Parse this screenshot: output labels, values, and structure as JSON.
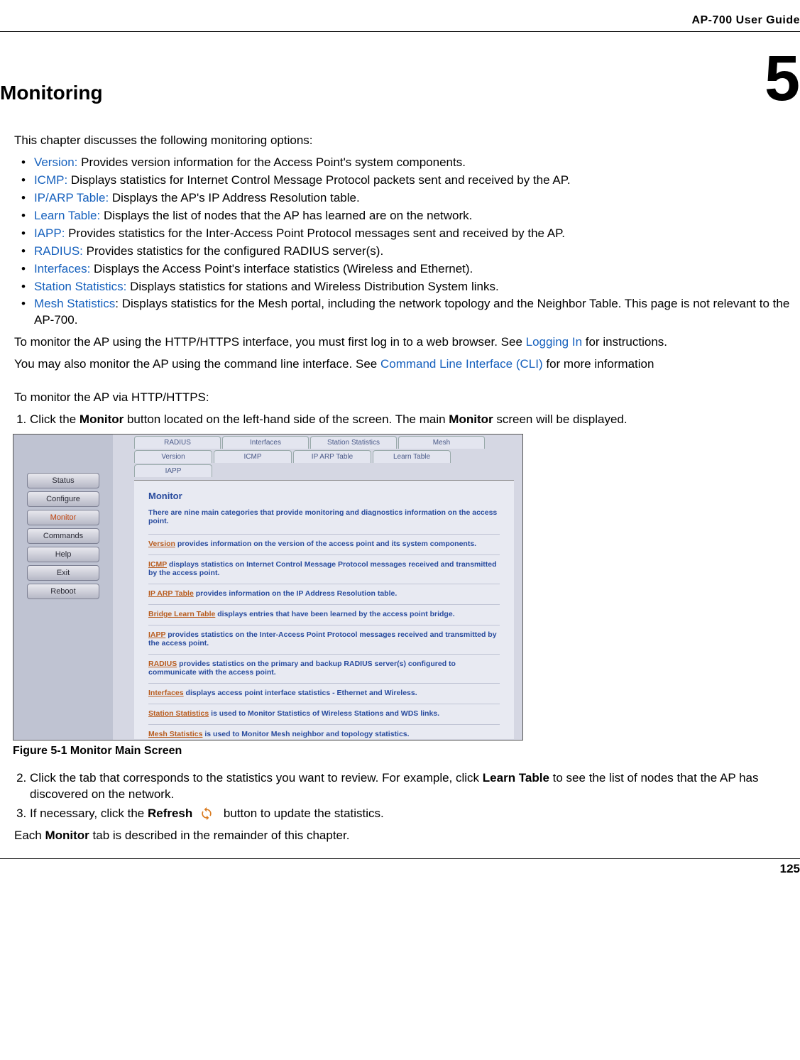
{
  "header": {
    "guide": "AP-700 User Guide"
  },
  "chapter": {
    "title": "Monitoring",
    "number": "5"
  },
  "intro": "This chapter discusses the following monitoring options:",
  "options": [
    {
      "link": "Version:",
      "desc": " Provides version information for the Access Point's system components."
    },
    {
      "link": "ICMP:",
      "desc": " Displays statistics for Internet Control Message Protocol packets sent and received by the AP."
    },
    {
      "link": "IP/ARP Table:",
      "desc": " Displays the AP's IP Address Resolution table."
    },
    {
      "link": "Learn Table:",
      "desc": " Displays the list of nodes that the AP has learned are on the network."
    },
    {
      "link": "IAPP:",
      "desc": " Provides statistics for the Inter-Access Point Protocol messages sent and received by the AP."
    },
    {
      "link": "RADIUS:",
      "desc": " Provides statistics for the configured RADIUS server(s)."
    },
    {
      "link": "Interfaces:",
      "desc": " Displays the Access Point's interface statistics (Wireless and Ethernet)."
    },
    {
      "link": "Station Statistics:",
      "desc": " Displays statistics for stations and Wireless Distribution System links."
    },
    {
      "link": "Mesh Statistics",
      "desc": ": Displays statistics for the Mesh portal, including the network topology and the Neighbor Table. This page is not relevant to the AP-700."
    }
  ],
  "http_note": {
    "pre": "To monitor the AP using the HTTP/HTTPS interface, you must first log in to a web browser. See ",
    "link": "Logging In",
    "post": " for instructions."
  },
  "cli_note": {
    "pre": "You may also monitor the AP using the command line interface. See ",
    "link": "Command Line Interface (CLI)",
    "post": " for more information"
  },
  "via_heading": "To monitor the AP via HTTP/HTTPS:",
  "step1": {
    "pre": "Click the ",
    "b1": "Monitor",
    "mid": " button located on the left-hand side of the screen. The main ",
    "b2": "Monitor",
    "post": " screen will be displayed."
  },
  "screenshot": {
    "sidebar": [
      "Status",
      "Configure",
      "Monitor",
      "Commands",
      "Help",
      "Exit",
      "Reboot"
    ],
    "tabs_row1": [
      "RADIUS",
      "Interfaces",
      "Station Statistics",
      "Mesh"
    ],
    "tabs_row2": [
      "Version",
      "ICMP",
      "IP ARP Table",
      "Learn Table",
      "IAPP"
    ],
    "panel_title": "Monitor",
    "panel_desc": "There are nine main categories that provide monitoring and diagnostics information on the access point.",
    "rows": [
      {
        "u": "Version",
        "t": " provides information on the version of the access point and its system components."
      },
      {
        "u": "ICMP",
        "t": " displays statistics on Internet Control Message Protocol messages received and transmitted by the access point."
      },
      {
        "u": "IP ARP Table",
        "t": " provides information on the IP Address Resolution table."
      },
      {
        "u": "Bridge Learn Table",
        "t": " displays entries that have been learned by the access point bridge."
      },
      {
        "u": "IAPP",
        "t": " provides statistics on the Inter-Access Point Protocol messages received and transmitted by the access point."
      },
      {
        "u": "RADIUS",
        "t": " provides statistics on the primary and backup RADIUS server(s) configured to communicate with the access point."
      },
      {
        "u": "Interfaces",
        "t": " displays access point interface statistics - Ethernet and Wireless."
      },
      {
        "u": "Station Statistics",
        "t": " is used to Monitor Statistics of Wireless Stations and WDS links."
      },
      {
        "u": "Mesh Statistics",
        "t": " is used to Monitor Mesh neighbor and topology statistics."
      }
    ]
  },
  "figure_caption": "Figure 5-1 Monitor Main Screen",
  "step2": {
    "pre": "Click the tab that corresponds to the statistics you want to review. For example, click ",
    "b": "Learn Table",
    "post": " to see the list of nodes that the AP has discovered on the network."
  },
  "step3": {
    "pre": "If necessary, click the ",
    "b": "Refresh",
    "post": " button to update the statistics."
  },
  "closing": {
    "pre": "Each ",
    "b": "Monitor",
    "post": " tab is described in the remainder of this chapter."
  },
  "page_number": "125"
}
